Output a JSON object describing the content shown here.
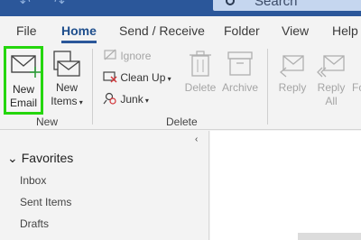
{
  "titlebar": {
    "search_placeholder": "Search"
  },
  "tabs": [
    {
      "label": "File"
    },
    {
      "label": "Home"
    },
    {
      "label": "Send / Receive"
    },
    {
      "label": "Folder"
    },
    {
      "label": "View"
    },
    {
      "label": "Help"
    }
  ],
  "ribbon": {
    "new_email": {
      "line1": "New",
      "line2": "Email"
    },
    "new_items": {
      "line1": "New",
      "line2": "Items"
    },
    "group_new": "New",
    "ignore": "Ignore",
    "clean_up": "Clean Up",
    "junk": "Junk",
    "delete": "Delete",
    "archive": "Archive",
    "group_delete": "Delete",
    "reply": "Reply",
    "reply_all": {
      "line1": "Reply",
      "line2": "All"
    },
    "forward": "Forw"
  },
  "nav": {
    "favorites": "Favorites",
    "items": [
      "Inbox",
      "Sent Items",
      "Drafts"
    ]
  },
  "colors": {
    "titlebar": "#2b579a",
    "highlight": "#25d60d",
    "accent": "#1e4e8c"
  }
}
